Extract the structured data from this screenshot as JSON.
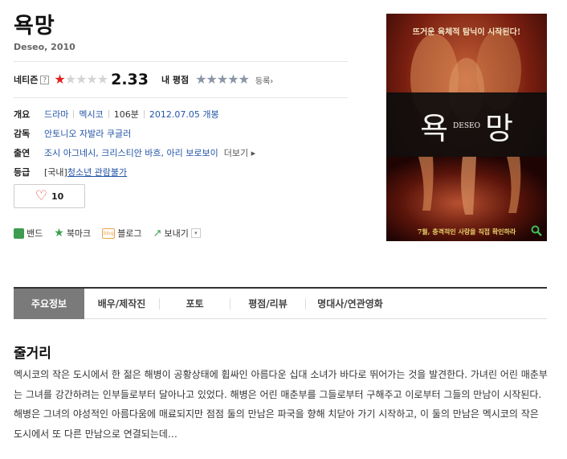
{
  "movie": {
    "title": "욕망",
    "subtitle": "Deseo, 2010"
  },
  "ratings": {
    "netizen_label": "네티즌",
    "netizen_help": "?",
    "netizen_score": "2.33",
    "netizen_stars": 1,
    "my_rating_label": "내 평점",
    "my_rating_stars": 0,
    "register_label": "등록›"
  },
  "info": {
    "overview_label": "개요",
    "genre": "드라마",
    "country": "멕시코",
    "runtime": "106분",
    "release": "2012.07.05 개봉",
    "director_label": "감독",
    "director": "안토니오 자발라 쿠글러",
    "cast_label": "출연",
    "cast": "조시 아그네시, 크리스티안 바흐, 아리 보로보이",
    "more_label": "더보기 ▸",
    "grade_label": "등급",
    "grade_prefix": "[국내]",
    "grade": "청소년 관람불가"
  },
  "like": {
    "icon": "heart-icon",
    "count": "10"
  },
  "share": {
    "band": "밴드",
    "bookmark": "북마크",
    "blog_icon_text": "blog",
    "blog": "블로그",
    "send": "보내기",
    "send_dropdown": "▾"
  },
  "poster": {
    "tagline_top": "뜨거운 육체적 탐닉이 시작된다!",
    "title_left": "욕",
    "title_en": "DESEO",
    "title_right": "망",
    "tagline_bottom": "7월, 충격적인 사랑을 직접 확인하라",
    "search_icon": "search-icon",
    "colors": {
      "bg": "#2a0605",
      "band": "#0d0d0d",
      "accent": "#e6ce6a"
    }
  },
  "tabs": [
    {
      "label": "주요정보",
      "active": true
    },
    {
      "label": "배우/제작진",
      "active": false
    },
    {
      "label": "포토",
      "active": false
    },
    {
      "label": "평점/리뷰",
      "active": false
    },
    {
      "label": "명대사/연관영화",
      "active": false
    }
  ],
  "synopsis": {
    "title": "줄거리",
    "text": "멕시코의 작은 도시에서 한 젊은 해병이 공황상태에 휩싸인 아름다운 십대 소녀가 바다로 뛰어가는 것을 발견한다. 가녀린 어린 매춘부는 그녀를 강간하려는 인부들로부터 달아나고 있었다. 해병은 어린 매춘부를 그들로부터 구해주고 이로부터 그들의 만남이 시작된다. 해병은 그녀의 야성적인 아름다움에 매료되지만 점점 둘의 만남은 파국을 향해 치닫아 가기 시작하고, 이 둘의 만남은 멕시코의 작은 도시에서 또 다른 만남으로 연결되는데…"
  }
}
